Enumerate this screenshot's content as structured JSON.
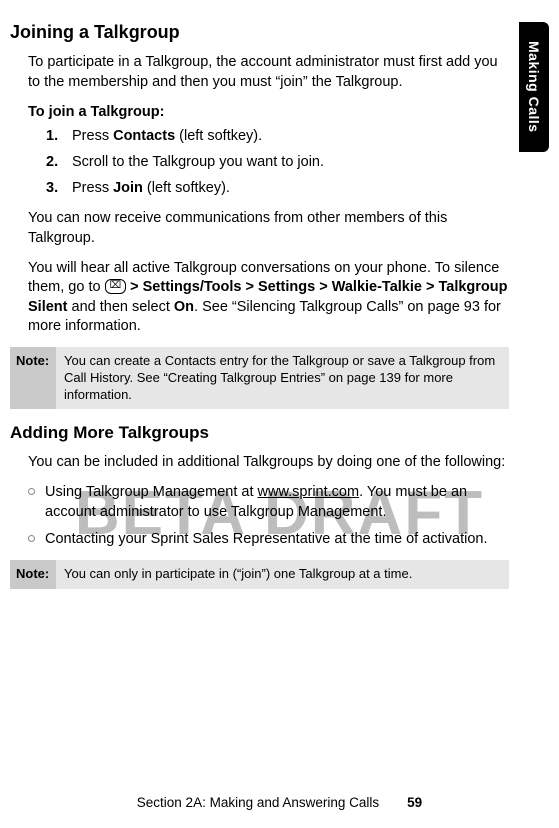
{
  "side_tab": "Making Calls",
  "watermark": "BETA DRAFT",
  "h1": "Joining a Talkgroup",
  "intro1": "To participate in a Talkgroup, the account administrator must first add you to the membership and then you must “join” the Talkgroup.",
  "subhead1": "To join a Talkgroup:",
  "steps": [
    {
      "num": "1.",
      "pre": "Press ",
      "bold": "Contacts",
      "post": " (left softkey)."
    },
    {
      "num": "2.",
      "pre": "Scroll to the Talkgroup you want to join.",
      "bold": "",
      "post": ""
    },
    {
      "num": "3.",
      "pre": "Press ",
      "bold": "Join",
      "post": " (left softkey)."
    }
  ],
  "para2": "You can now receive communications from other members of this Talkgroup.",
  "para3_pre": "You will hear all active Talkgroup conversations on your phone. To silence them, go to ",
  "icon_glyph": "⌧",
  "para3_bold": " > Settings/Tools > Settings > Walkie-Talkie > Talkgroup Silent",
  "para3_mid": " and then select ",
  "para3_bold2": "On",
  "para3_post": ". See “Silencing Talkgroup Calls” on page 93 for more information.",
  "note1_label": "Note:",
  "note1_body": "You can create a Contacts entry for the Talkgroup or save a Talkgroup from Call History. See “Creating Talkgroup Entries” on page 139 for more information.",
  "h2": "Adding More Talkgroups",
  "para4": "You can be included in additional Talkgroups by doing one of the following:",
  "bullets": [
    {
      "pre": "Using Talkgroup Management at ",
      "link": "www.sprint.com",
      "post": ". You must be an account administrator to use Talkgroup Management."
    },
    {
      "pre": "Contacting your Sprint Sales Representative at the time of activation.",
      "link": "",
      "post": ""
    }
  ],
  "note2_label": "Note:",
  "note2_body": "You can only in participate in (“join”) one Talkgroup at a time.",
  "footer_text": "Section 2A: Making and Answering Calls",
  "footer_page": "59"
}
